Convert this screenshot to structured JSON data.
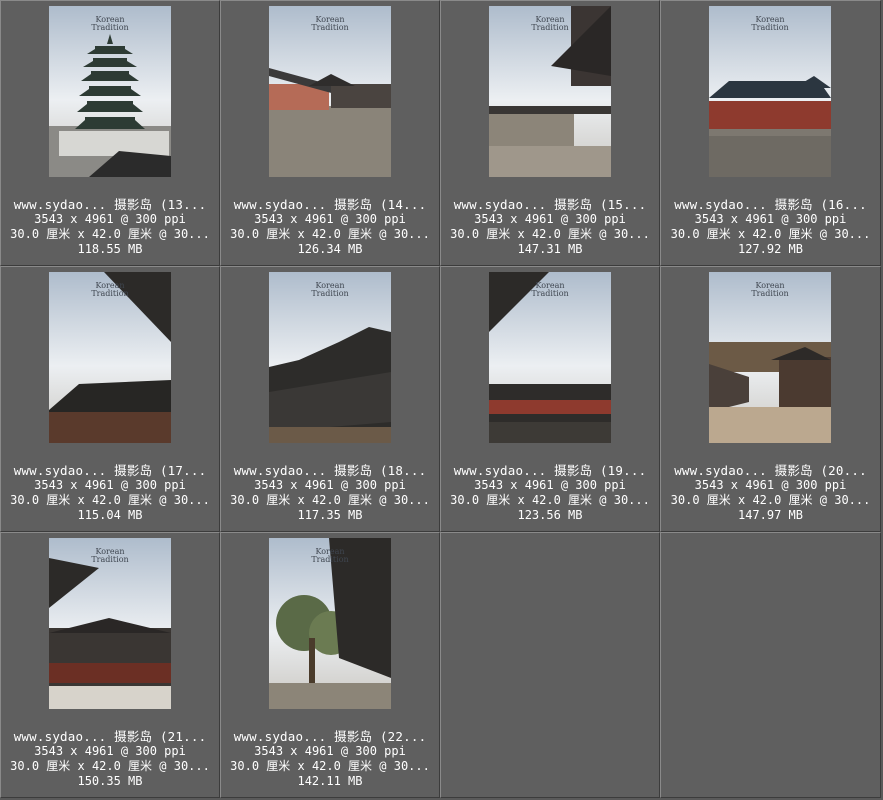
{
  "thumbnail_brand": {
    "title_line1": "Korean",
    "title_line2": "Tradition"
  },
  "items": [
    {
      "name": "www.sydao... 摄影岛 (13...",
      "pixels": "3543 x 4961 @ 300 ppi",
      "size_cm": "30.0 厘米 x 42.0 厘米 @ 30...",
      "file_size": "118.55 MB",
      "scene": "pagoda"
    },
    {
      "name": "www.sydao... 摄影岛 (14...",
      "pixels": "3543 x 4961 @ 300 ppi",
      "size_cm": "30.0 厘米 x 42.0 厘米 @ 30...",
      "file_size": "126.34 MB",
      "scene": "courtyard"
    },
    {
      "name": "www.sydao... 摄影岛 (15...",
      "pixels": "3543 x 4961 @ 300 ppi",
      "size_cm": "30.0 厘米 x 42.0 厘米 @ 30...",
      "file_size": "147.31 MB",
      "scene": "wall"
    },
    {
      "name": "www.sydao... 摄影岛 (16...",
      "pixels": "3543 x 4961 @ 300 ppi",
      "size_cm": "30.0 厘米 x 42.0 厘米 @ 30...",
      "file_size": "127.92 MB",
      "scene": "roofhall"
    },
    {
      "name": "www.sydao... 摄影岛 (17...",
      "pixels": "3543 x 4961 @ 300 ppi",
      "size_cm": "30.0 厘米 x 42.0 厘米 @ 30...",
      "file_size": "115.04 MB",
      "scene": "eaves"
    },
    {
      "name": "www.sydao... 摄影岛 (18...",
      "pixels": "3543 x 4961 @ 300 ppi",
      "size_cm": "30.0 厘米 x 42.0 厘米 @ 30...",
      "file_size": "117.35 MB",
      "scene": "roofs"
    },
    {
      "name": "www.sydao... 摄影岛 (19...",
      "pixels": "3543 x 4961 @ 300 ppi",
      "size_cm": "30.0 厘米 x 42.0 厘米 @ 30...",
      "file_size": "123.56 MB",
      "scene": "eaves2"
    },
    {
      "name": "www.sydao... 摄影岛 (20...",
      "pixels": "3543 x 4961 @ 300 ppi",
      "size_cm": "30.0 厘米 x 42.0 厘米 @ 30...",
      "file_size": "147.97 MB",
      "scene": "pavilion"
    },
    {
      "name": "www.sydao... 摄影岛 (21...",
      "pixels": "3543 x 4961 @ 300 ppi",
      "size_cm": "30.0 厘米 x 42.0 厘米 @ 30...",
      "file_size": "150.35 MB",
      "scene": "gate"
    },
    {
      "name": "www.sydao... 摄影岛 (22...",
      "pixels": "3543 x 4961 @ 300 ppi",
      "size_cm": "30.0 厘米 x 42.0 厘米 @ 30...",
      "file_size": "142.11 MB",
      "scene": "tree"
    }
  ],
  "colors": {
    "background": "#5a5a5a",
    "cell": "#5f5f5f",
    "caption_text": "#ffffff"
  }
}
